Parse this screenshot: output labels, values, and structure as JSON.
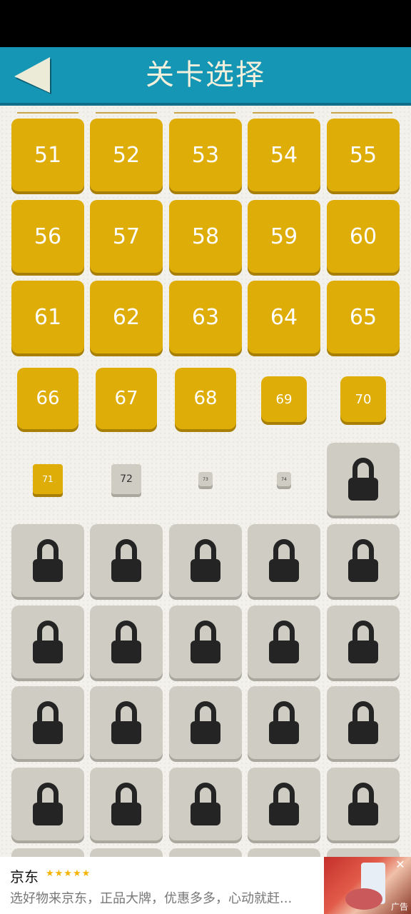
{
  "header": {
    "title": "关卡选择",
    "back_icon": "back-triangle-icon",
    "color": "#1696b5"
  },
  "levels": {
    "rows": [
      [
        {
          "n": "51",
          "state": "unlocked"
        },
        {
          "n": "52",
          "state": "unlocked"
        },
        {
          "n": "53",
          "state": "unlocked"
        },
        {
          "n": "54",
          "state": "unlocked"
        },
        {
          "n": "55",
          "state": "unlocked"
        }
      ],
      [
        {
          "n": "56",
          "state": "unlocked"
        },
        {
          "n": "57",
          "state": "unlocked"
        },
        {
          "n": "58",
          "state": "unlocked"
        },
        {
          "n": "59",
          "state": "unlocked"
        },
        {
          "n": "60",
          "state": "unlocked"
        }
      ],
      [
        {
          "n": "61",
          "state": "unlocked"
        },
        {
          "n": "62",
          "state": "unlocked"
        },
        {
          "n": "63",
          "state": "unlocked"
        },
        {
          "n": "64",
          "state": "unlocked"
        },
        {
          "n": "65",
          "state": "unlocked"
        }
      ],
      [
        {
          "n": "66",
          "state": "unlocked"
        },
        {
          "n": "67",
          "state": "unlocked"
        },
        {
          "n": "68",
          "state": "unlocked"
        },
        {
          "n": "69",
          "state": "unlocked"
        },
        {
          "n": "70",
          "state": "unlocked"
        }
      ],
      [
        {
          "n": "71",
          "state": "unlocked"
        },
        {
          "n": "72",
          "state": "gray"
        },
        {
          "n": "73",
          "state": "gray"
        },
        {
          "n": "74",
          "state": "gray"
        },
        {
          "n": "",
          "state": "locked"
        }
      ]
    ],
    "locked_icon": "lock-icon",
    "gold_color": "#dfad08"
  },
  "ad": {
    "brand": "京东",
    "stars": "★★★★★",
    "description": "选好物来京东，正品大牌，优惠多多，心动就赶...",
    "label": "广告",
    "close_icon": "close-icon"
  }
}
